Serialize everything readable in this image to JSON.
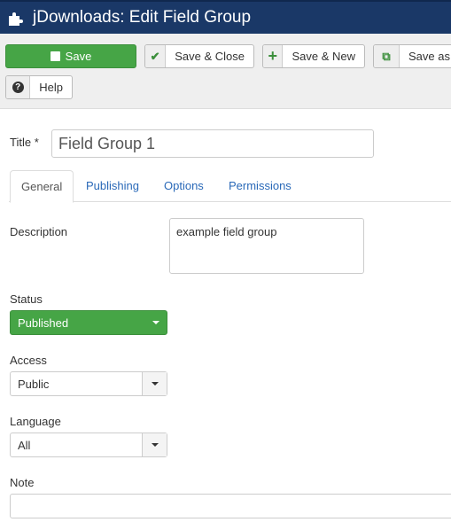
{
  "header": {
    "title": "jDownloads: Edit Field Group",
    "icon": "puzzle-icon"
  },
  "toolbar": {
    "save": "Save",
    "save_close": "Save & Close",
    "save_new": "Save & New",
    "save_copy": "Save as Copy",
    "help": "Help"
  },
  "form": {
    "title_label": "Title *",
    "title_value": "Field Group 1",
    "tabs": [
      "General",
      "Publishing",
      "Options",
      "Permissions"
    ],
    "description_label": "Description",
    "description_value": "example field group",
    "status_label": "Status",
    "status_value": "Published",
    "access_label": "Access",
    "access_value": "Public",
    "language_label": "Language",
    "language_value": "All",
    "note_label": "Note",
    "note_value": ""
  },
  "colors": {
    "header": "#1a3867",
    "save": "#46a546",
    "link": "#2a69b8"
  }
}
